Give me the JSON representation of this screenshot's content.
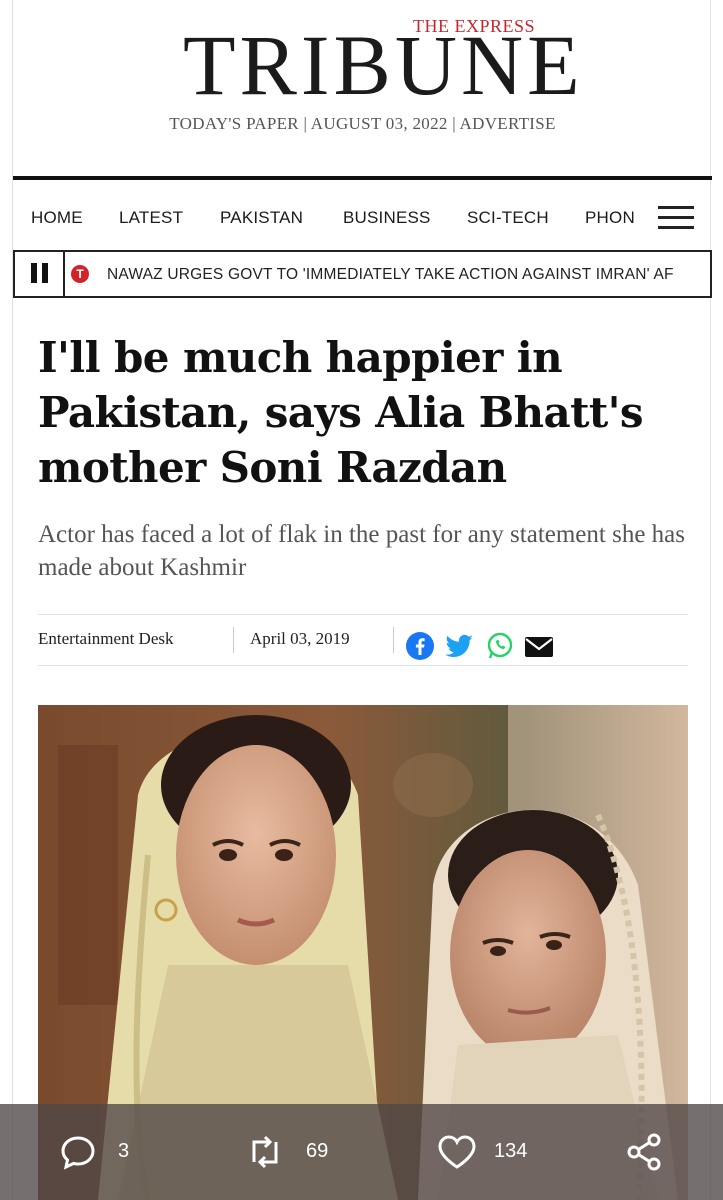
{
  "masthead": {
    "brand_small": "THE EXPRESS",
    "brand_big": "TRIBUNE",
    "meta": "TODAY'S PAPER | AUGUST 03, 2022 | ADVERTISE"
  },
  "nav": {
    "items": [
      "HOME",
      "LATEST",
      "PAKISTAN",
      "BUSINESS",
      "SCI-TECH",
      "PHON"
    ]
  },
  "ticker": {
    "logo_letter": "T",
    "text": "NAWAZ URGES GOVT TO 'IMMEDIATELY TAKE ACTION AGAINST IMRAN' AF"
  },
  "article": {
    "headline": "I'll be much happier in Pakistan, says Alia Bhatt's mother Soni Razdan",
    "deck": "Actor has faced a lot of flak in the past for any statement she has made about Kashmir",
    "byline": "Entertainment Desk",
    "date": "April 03, 2019",
    "share_icons": [
      "facebook-icon",
      "twitter-icon",
      "whatsapp-icon",
      "email-icon"
    ]
  },
  "social": {
    "replies": "3",
    "retweets": "69",
    "likes": "134"
  },
  "colors": {
    "brand_red": "#c8262d",
    "facebook": "#1877f2",
    "twitter": "#1da1f2",
    "whatsapp": "#25d366"
  }
}
